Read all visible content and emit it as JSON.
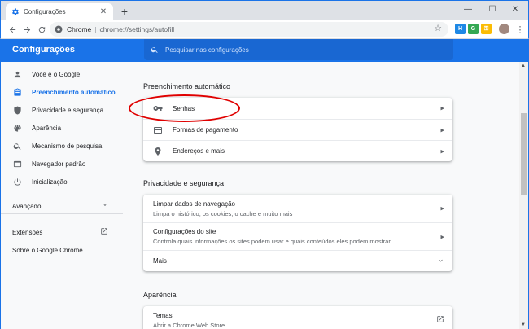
{
  "browser": {
    "tab_title": "Configurações",
    "new_tab_symbol": "+",
    "close_symbol": "✕",
    "minimize_symbol": "—",
    "maximize_symbol": "☐",
    "window_close_symbol": "✕",
    "omnibox_site": "Chrome",
    "omnibox_separator": "|",
    "omnibox_url": "chrome://settings/autofill",
    "accent_color": "#1a73e8"
  },
  "header": {
    "title": "Configurações",
    "search_placeholder": "Pesquisar nas configurações"
  },
  "sidebar": {
    "items": [
      {
        "label": "Você e o Google",
        "icon": "person-icon"
      },
      {
        "label": "Preenchimento automático",
        "icon": "clipboard-icon",
        "active": true
      },
      {
        "label": "Privacidade e segurança",
        "icon": "shield-icon"
      },
      {
        "label": "Aparência",
        "icon": "palette-icon"
      },
      {
        "label": "Mecanismo de pesquisa",
        "icon": "search-icon"
      },
      {
        "label": "Navegador padrão",
        "icon": "browser-icon"
      },
      {
        "label": "Inicialização",
        "icon": "power-icon"
      }
    ],
    "advanced_label": "Avançado",
    "extensions_label": "Extensões",
    "about_label": "Sobre o Google Chrome"
  },
  "autofill": {
    "section_title": "Preenchimento automático",
    "rows": [
      {
        "label": "Senhas",
        "icon": "key-icon"
      },
      {
        "label": "Formas de pagamento",
        "icon": "credit-card-icon"
      },
      {
        "label": "Endereços e mais",
        "icon": "location-pin-icon"
      }
    ]
  },
  "privacy": {
    "section_title": "Privacidade e segurança",
    "rows": [
      {
        "title": "Limpar dados de navegação",
        "subtitle": "Limpa o histórico, os cookies, o cache e muito mais"
      },
      {
        "title": "Configurações do site",
        "subtitle": "Controla quais informações os sites podem usar e quais conteúdos eles podem mostrar"
      }
    ],
    "more_label": "Mais"
  },
  "appearance": {
    "section_title": "Aparência",
    "themes_title": "Temas",
    "themes_subtitle": "Abrir a Chrome Web Store"
  }
}
